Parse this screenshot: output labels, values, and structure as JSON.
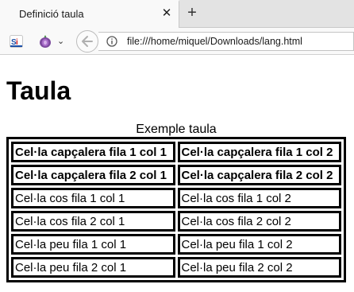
{
  "browser": {
    "tab_title": "Definició taula",
    "tab_close": "✕",
    "new_tab": "+",
    "url": "file:///home/miquel/Downloads/lang.html",
    "ext_caret": "⌄"
  },
  "page": {
    "heading": "Taula",
    "table": {
      "caption": "Exemple taula",
      "head": [
        [
          "Cel·la capçalera fila 1 col 1",
          "Cel·la capçalera fila 1 col 2"
        ],
        [
          "Cel·la capçalera fila 2 col 1",
          "Cel·la capçalera fila 2 col 2"
        ]
      ],
      "body": [
        [
          "Cel·la cos fila 1 col 1",
          "Cel·la cos fila 1 col 2"
        ],
        [
          "Cel·la cos fila 2 col 1",
          "Cel·la cos fila 2 col 2"
        ]
      ],
      "foot": [
        [
          "Cel·la peu fila 1 col 1",
          "Cel·la peu fila 1 col 2"
        ],
        [
          "Cel·la peu fila 2 col 1",
          "Cel·la peu fila 2 col 2"
        ]
      ]
    }
  }
}
